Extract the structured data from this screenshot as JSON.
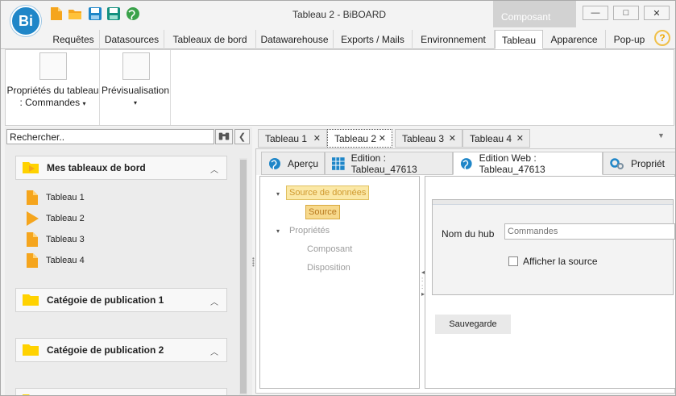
{
  "window": {
    "title": "Tableau 2 - BiBOARD",
    "logo_text": "Bi",
    "context_label": "Composant",
    "minimize_glyph": "—",
    "maximize_glyph": "□",
    "close_glyph": "✕",
    "help_glyph": "?"
  },
  "ribbon_tabs": [
    {
      "label": "Requêtes"
    },
    {
      "label": "Datasources"
    },
    {
      "label": "Tableaux de bord"
    },
    {
      "label": "Datawarehouse"
    },
    {
      "label": "Exports / Mails"
    },
    {
      "label": "Environnement"
    },
    {
      "label": "Tableau",
      "active": true
    },
    {
      "label": "Apparence"
    },
    {
      "label": "Pop-up"
    }
  ],
  "ribbon": {
    "group1_label_line1": "Propriétés du tableau",
    "group1_label_line2": ": Commandes",
    "group2_label": "Prévisualisation",
    "caret": "▾"
  },
  "left_panel": {
    "search_value": "Rechercher..",
    "collapse_glyph": "❮",
    "sections": [
      {
        "label": "Mes tableaux de bord",
        "chevron": "︿"
      },
      {
        "label": "Catégoie de publication 1",
        "chevron": "︿"
      },
      {
        "label": "Catégoie de publication 2",
        "chevron": "︿"
      }
    ],
    "items": [
      {
        "label": "Tableau 1"
      },
      {
        "label": "Tableau 2"
      },
      {
        "label": "Tableau 3"
      },
      {
        "label": "Tableau 4"
      }
    ]
  },
  "doc_tabs": [
    {
      "label": "Tableau 1",
      "close": "✕"
    },
    {
      "label": "Tableau 2",
      "close": "✕",
      "active": true
    },
    {
      "label": "Tableau 3",
      "close": "✕"
    },
    {
      "label": "Tableau 4",
      "close": "✕"
    }
  ],
  "doc_tabs_menu_glyph": "▼",
  "sub_tabs": [
    {
      "label": "Aperçu"
    },
    {
      "label": "Edition : Tableau_47613"
    },
    {
      "label": "Edition Web : Tableau_47613",
      "active": true
    },
    {
      "label": "Propriét"
    }
  ],
  "tree": {
    "arrow": "▾",
    "source_group": "Source de données",
    "source_item": "Source",
    "props_group": "Propriétés",
    "props_items": [
      "Composant",
      "Disposition"
    ]
  },
  "editor": {
    "hub_label": "Nom du hub",
    "hub_value": "Commandes",
    "show_source_label": "Afficher la source",
    "show_source_checked": false,
    "save_label": "Sauvegarde"
  },
  "colors": {
    "accent_blue": "#1f86c8",
    "folder_orange": "#f5a51d",
    "folder_yellow": "#ffd200",
    "tree_highlight": "#fbe8a6"
  }
}
